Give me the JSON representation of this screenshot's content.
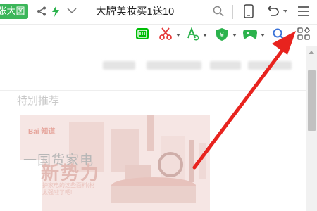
{
  "addressbar": {
    "green_button": "张大图",
    "address": "大牌美妆买1送10"
  },
  "page": {
    "special_title": "特别推荐",
    "banner": {
      "logo": "Bai 知道",
      "line1": "一国货家电",
      "line2": "新势力",
      "sub1": "护家电的这些面料(材",
      "sub2": "太强啦了吧!"
    }
  },
  "icons": [
    "share-icon",
    "bolt-icon",
    "chevron-down-icon",
    "search-icon",
    "phone-icon",
    "undo-icon",
    "menu-icon",
    "iqiyi-icon",
    "scissors-icon",
    "translate-icon",
    "shield-icon",
    "gamepad-icon",
    "search-icon",
    "apps-icon"
  ],
  "colors": {
    "accent_green": "#3cb65a",
    "arrow_red": "#e8231e",
    "scissors_red": "#e53a3a"
  }
}
